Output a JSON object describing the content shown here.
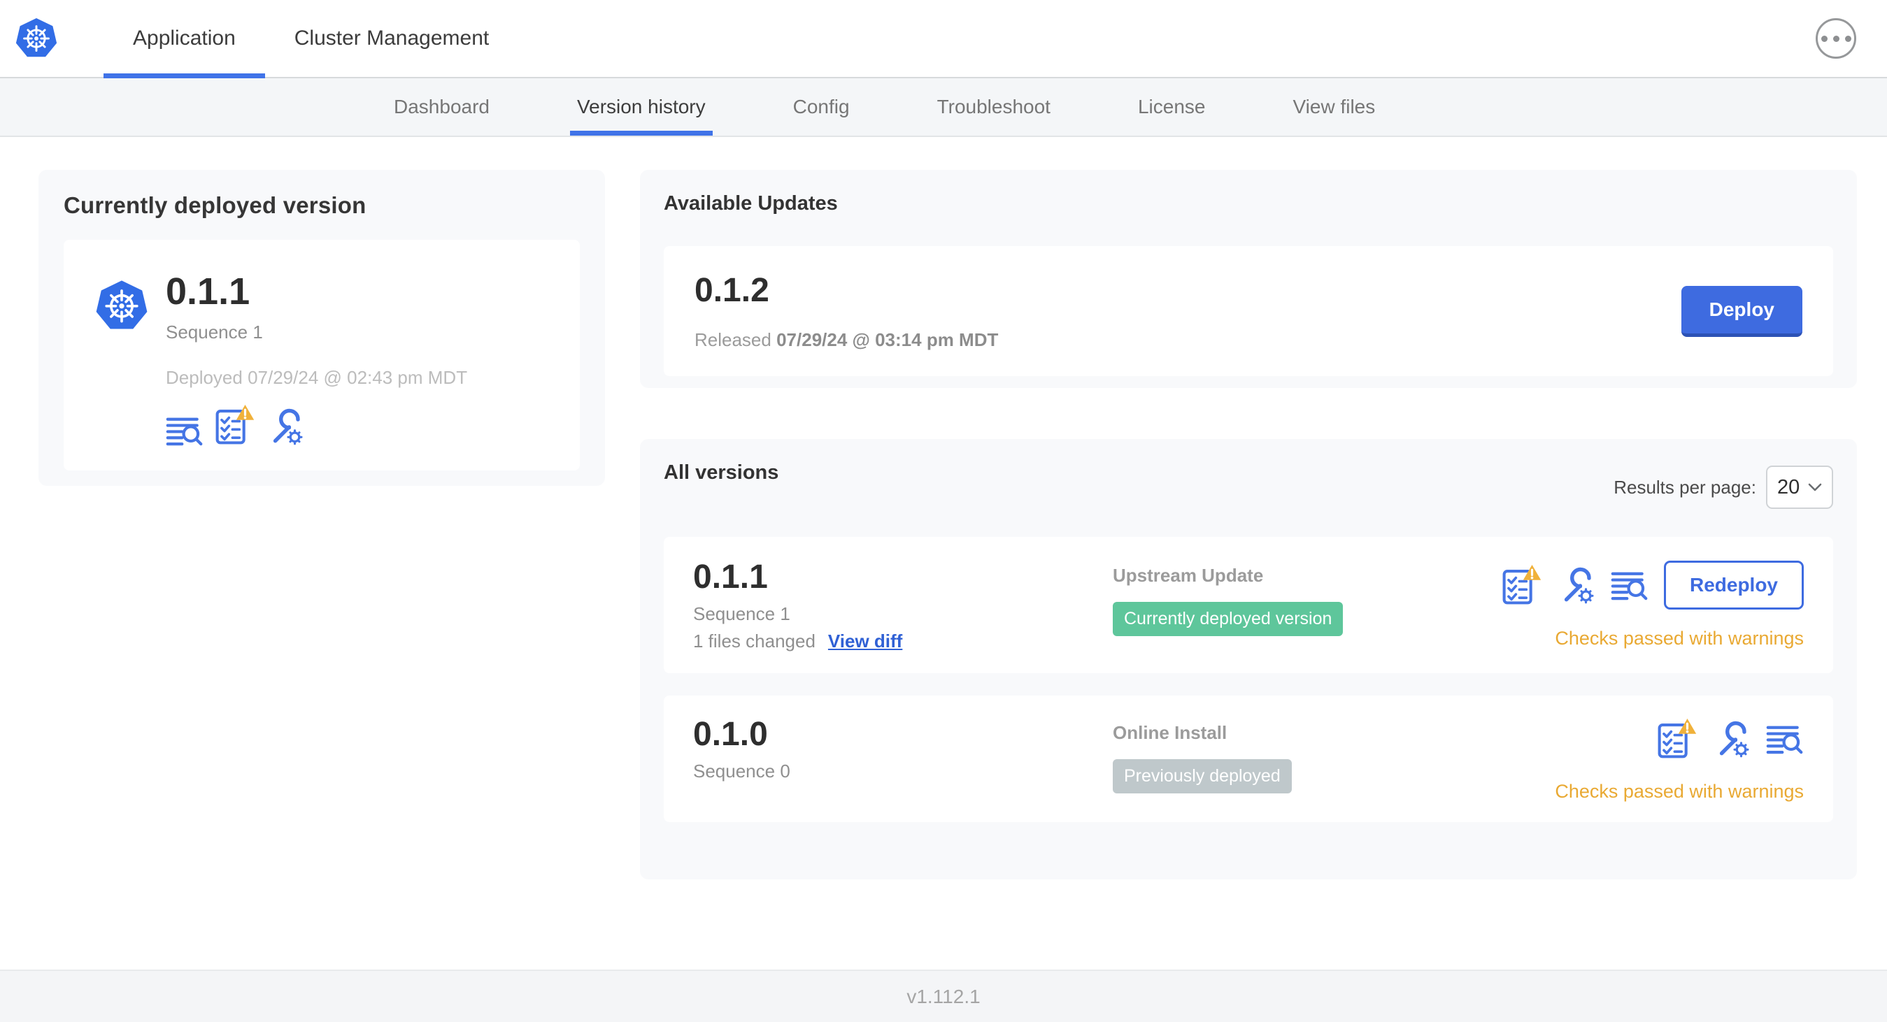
{
  "topnav": {
    "logo_icon": "kubernetes-logo",
    "tabs": [
      {
        "label": "Application",
        "active": true
      },
      {
        "label": "Cluster Management",
        "active": false
      }
    ],
    "more_icon": "ellipsis-icon"
  },
  "subnav": {
    "active": "Version history",
    "tabs": [
      {
        "label": "Dashboard"
      },
      {
        "label": "Version history"
      },
      {
        "label": "Config"
      },
      {
        "label": "Troubleshoot"
      },
      {
        "label": "License"
      },
      {
        "label": "View files"
      }
    ]
  },
  "current_version_card": {
    "title": "Currently deployed version",
    "app_icon": "kubernetes-logo",
    "version": "0.1.1",
    "sequence": "Sequence 1",
    "deployed_at": "Deployed 07/29/24 @ 02:43 pm MDT",
    "icons": [
      "view-logs-icon",
      "preflight-checks-warning-icon",
      "edit-config-icon"
    ]
  },
  "available_updates": {
    "title": "Available Updates",
    "update": {
      "version": "0.1.2",
      "released_label": "Released",
      "released_date": "07/29/24 @ 03:14 pm MDT",
      "deploy_label": "Deploy"
    }
  },
  "all_versions": {
    "title": "All versions",
    "results_per_page_label": "Results per page:",
    "results_per_page_value": "20",
    "rows": [
      {
        "version": "0.1.1",
        "sequence": "Sequence 1",
        "files_changed": "1 files changed",
        "view_diff_label": "View diff",
        "source": "Upstream Update",
        "badge_label": "Currently deployed version",
        "badge_color": "green",
        "icons": [
          "preflight-checks-warning-icon",
          "edit-config-icon",
          "view-logs-icon"
        ],
        "checks_status": "Checks passed with warnings",
        "action_label": "Redeploy"
      },
      {
        "version": "0.1.0",
        "sequence": "Sequence 0",
        "source": "Online Install",
        "badge_label": "Previously deployed",
        "badge_color": "gray",
        "icons": [
          "preflight-checks-warning-icon",
          "edit-config-icon",
          "view-logs-icon"
        ],
        "checks_status": "Checks passed with warnings"
      }
    ]
  },
  "footer": {
    "app_version": "v1.112.1"
  },
  "colors": {
    "accent_blue": "#3e6be0",
    "link_blue": "#3061d5",
    "warning_orange": "#e9a933",
    "badge_green": "#5ec69b",
    "badge_gray": "#bfc8cb",
    "card_bg": "#f8f9fb",
    "subnav_bg": "#f4f6f8"
  }
}
